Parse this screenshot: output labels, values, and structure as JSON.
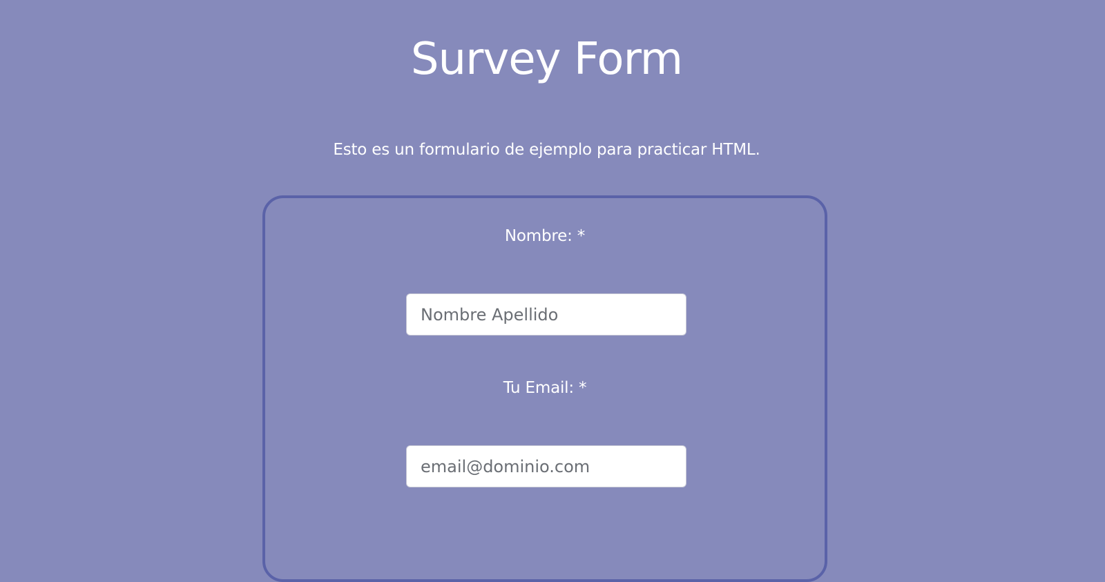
{
  "colors": {
    "background": "#868abb",
    "form_border": "#5a62a8",
    "text": "#ffffff",
    "input_background": "#ffffff"
  },
  "header": {
    "title": "Survey Form",
    "description": "Esto es un formulario de ejemplo para practicar HTML."
  },
  "form": {
    "name_label": "Nombre: *",
    "name_placeholder": "Nombre Apellido",
    "email_label": "Tu Email: *",
    "email_placeholder": "email@dominio.com"
  }
}
